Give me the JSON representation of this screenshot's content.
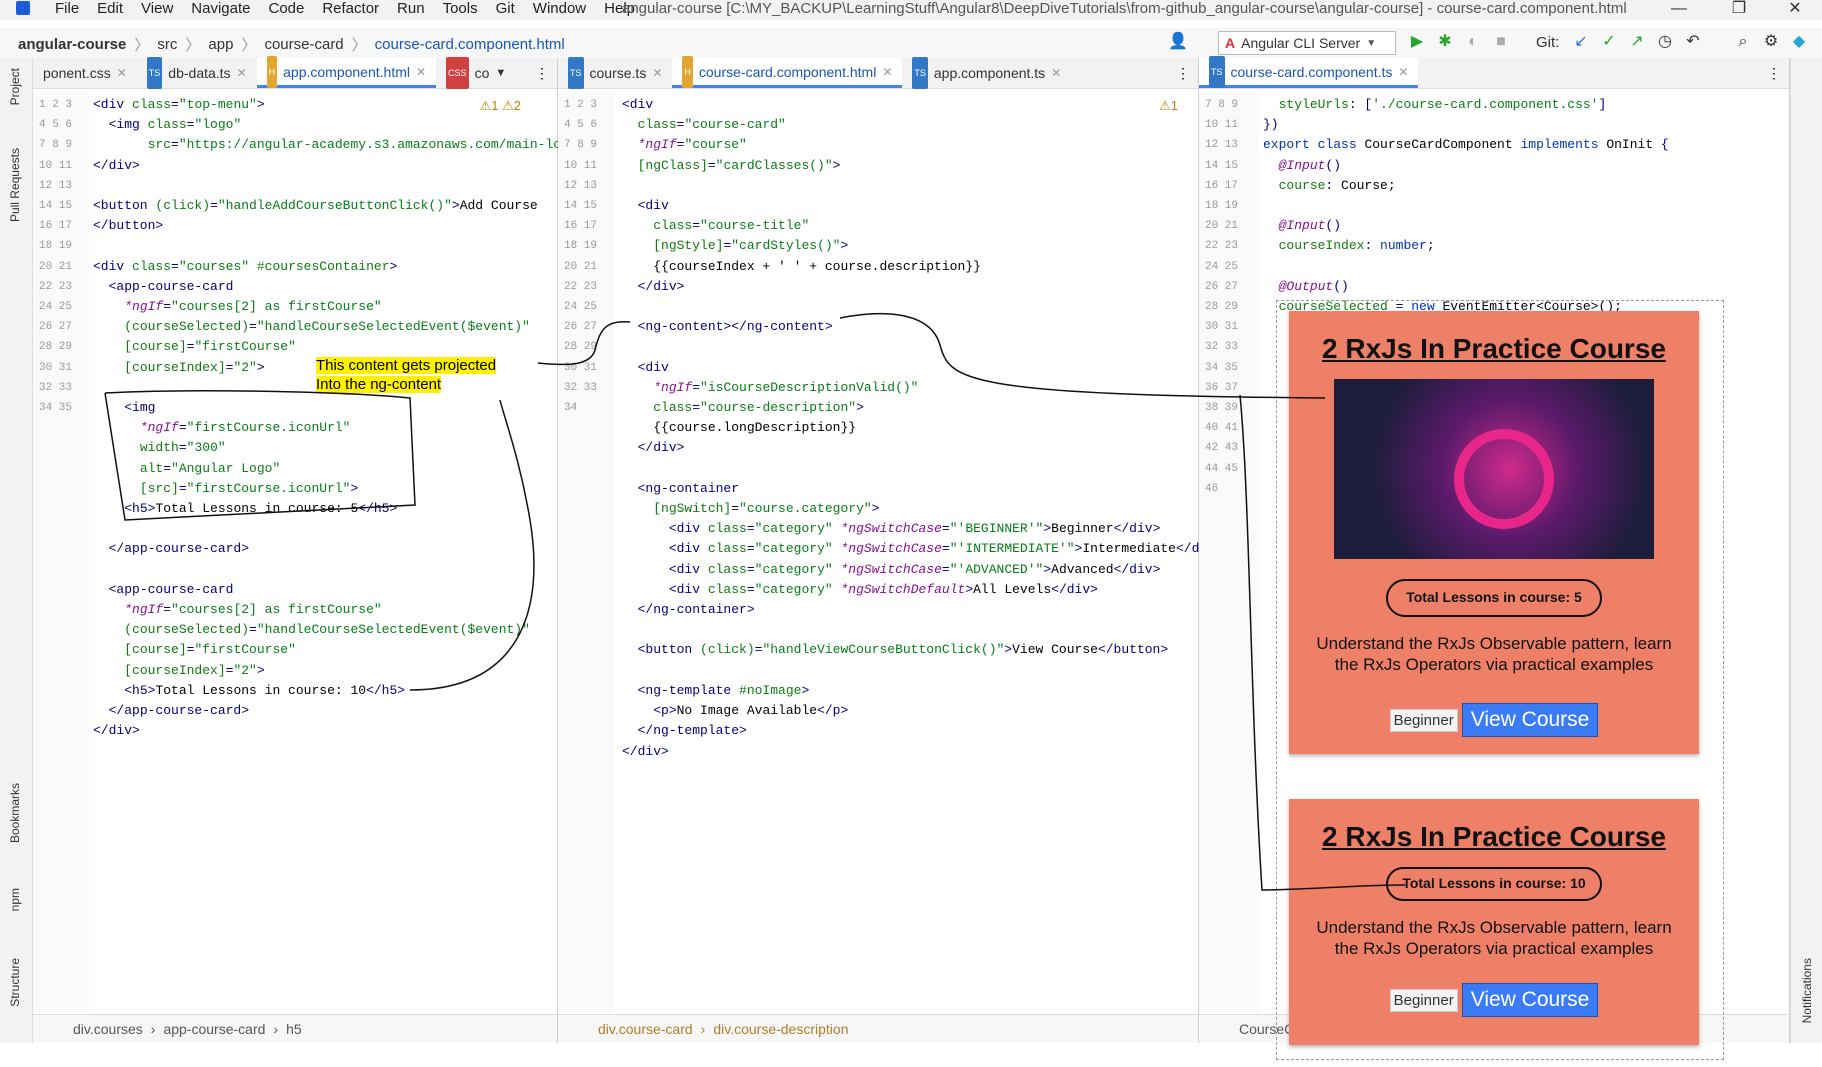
{
  "menubar": {
    "items": [
      "File",
      "Edit",
      "View",
      "Navigate",
      "Code",
      "Refactor",
      "Run",
      "Tools",
      "Git",
      "Window",
      "Help"
    ],
    "title": "angular-course [C:\\MY_BACKUP\\LearningStuff\\Angular8\\DeepDiveTutorials\\from-github_angular-course\\angular-course] - course-card.component.html",
    "minimize": "—",
    "restore": "❐",
    "close": "✕"
  },
  "navbar": {
    "crumbs": [
      "angular-course",
      "src",
      "app",
      "course-card",
      "course-card.component.html"
    ],
    "run_config": "Angular CLI Server",
    "git_label": "Git:"
  },
  "leftstrip": {
    "items": [
      "Project",
      "Pull Requests",
      "Bookmarks",
      "npm",
      "Structure"
    ]
  },
  "rightstrip": {
    "label": "Notifications"
  },
  "pane1": {
    "tabs": [
      {
        "label": "ponent.css",
        "icon": "css-file-icon",
        "active": false
      },
      {
        "label": "db-data.ts",
        "icon": "ts-file-icon",
        "active": false
      },
      {
        "label": "app.component.html",
        "icon": "html-file-icon",
        "active": true
      },
      {
        "label": "co",
        "icon": "css-file-icon",
        "active": false
      }
    ],
    "warnings": "⚠1  ⚠2",
    "status": [
      "div.courses",
      "app-course-card",
      "h5"
    ]
  },
  "pane2": {
    "tabs": [
      {
        "label": "course.ts",
        "icon": "ts-file-icon",
        "active": false
      },
      {
        "label": "course-card.component.html",
        "icon": "html-file-icon",
        "active": true
      },
      {
        "label": "app.component.ts",
        "icon": "ts-file-icon",
        "active": false
      }
    ],
    "warnings": "⚠1",
    "status": [
      "div.course-card",
      "div.course-description"
    ]
  },
  "pane3": {
    "tabs": [
      {
        "label": "course-card.component.ts",
        "icon": "ts-file-icon",
        "active": true
      }
    ],
    "status": [
      "CourseCard"
    ]
  },
  "annotation": {
    "line1": "This content gets projected",
    "line2": "Into the ng-content"
  },
  "preview": {
    "cards": [
      {
        "title": "2 RxJs In Practice Course",
        "lessons": "Total Lessons in course: 5",
        "description": "Understand the RxJs Observable pattern, learn the RxJs Operators via practical examples",
        "category": "Beginner",
        "button": "View Course",
        "has_image": true
      },
      {
        "title": "2 RxJs In Practice Course",
        "lessons": "Total Lessons in course: 10",
        "description": "Understand the RxJs Observable pattern, learn the RxJs Operators via practical examples",
        "category": "Beginner",
        "button": "View Course",
        "has_image": false
      }
    ]
  }
}
